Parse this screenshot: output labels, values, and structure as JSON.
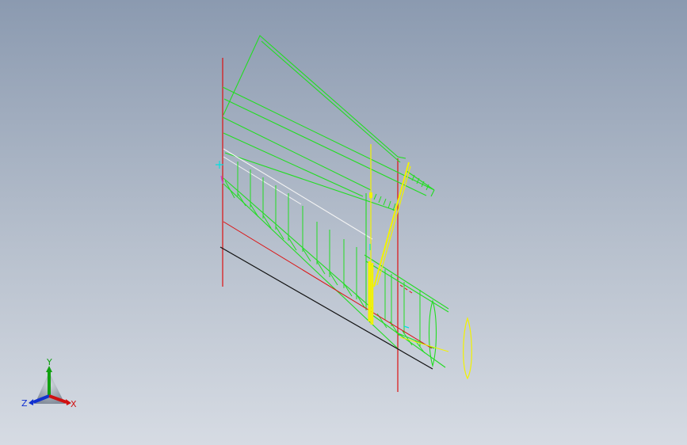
{
  "viewport": {
    "background_top": "#8b9ab0",
    "background_bottom": "#d6dbe3",
    "colors": {
      "construction_green": "#22dd22",
      "reference_red": "#dd1111",
      "highlight_yellow": "#f2f200",
      "edge_white": "#f4f4f4",
      "edge_black": "#111111",
      "marker_cyan": "#00e0e0"
    }
  },
  "triad": {
    "y_label": "Y",
    "z_label": "Z",
    "x_label": "X",
    "y_color": "#10a010",
    "z_color": "#1030d0",
    "x_color": "#d01010"
  }
}
